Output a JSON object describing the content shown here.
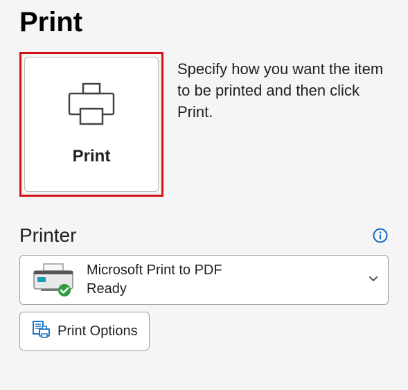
{
  "title": "Print",
  "printButton": {
    "label": "Print"
  },
  "instruction": "Specify how you want the item to be printed and then click Print.",
  "printerSection": {
    "title": "Printer",
    "selected": {
      "name": "Microsoft Print to PDF",
      "status": "Ready"
    },
    "optionsLabel": "Print Options"
  }
}
